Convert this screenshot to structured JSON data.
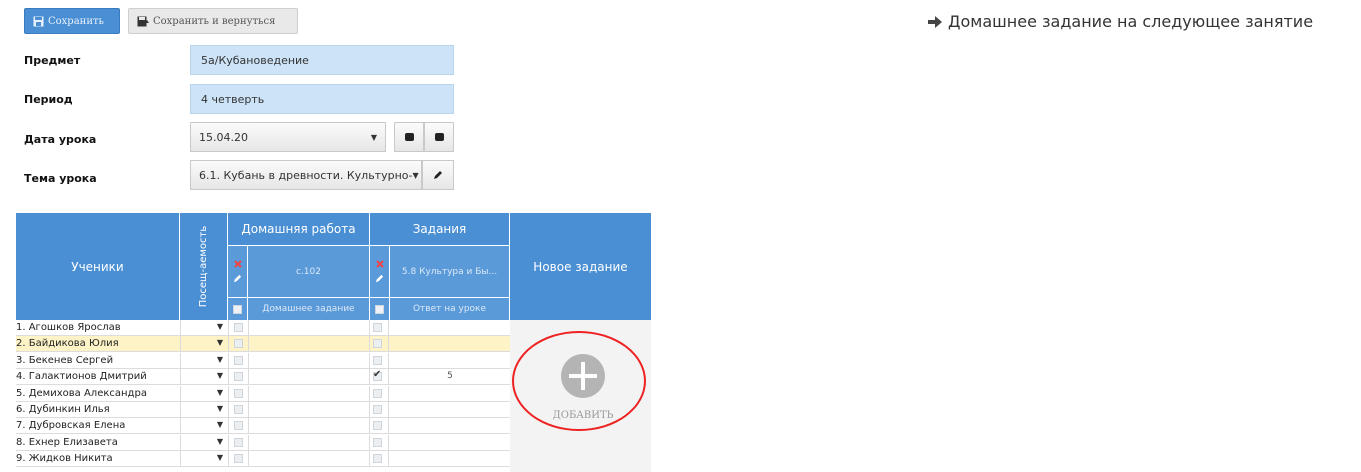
{
  "toolbar": {
    "save_label": "Сохранить",
    "save_return_label": "Сохранить и вернуться"
  },
  "top_link": {
    "label": "Домашнее задание на следующее занятие"
  },
  "form": {
    "subject_label": "Предмет",
    "subject_value": "5а/Кубановедение",
    "period_label": "Период",
    "period_value": "4 четверть",
    "date_label": "Дата урока",
    "date_value": "15.04.20",
    "topic_label": "Тема урока",
    "topic_value": "6.1. Кубань в древности. Культурно-"
  },
  "table": {
    "students_header": "Ученики",
    "attendance_header": "Посещ-аемость",
    "homework_header": "Домашняя работа",
    "tasks_header": "Задания",
    "new_task_header": "Новое задание",
    "homework_value": "с.102",
    "task_value": "5.8 Культура и Бы...",
    "homework_sub": "Домашнее задание",
    "task_sub": "Ответ на уроке",
    "add_label": "ДОБАВИТЬ",
    "students": [
      {
        "name": "1. Агошков Ярослав",
        "grade": "",
        "checked": false,
        "highlight": false
      },
      {
        "name": "2. Байдикова Юлия",
        "grade": "",
        "checked": false,
        "highlight": true
      },
      {
        "name": "3. Бекенев Сергей",
        "grade": "",
        "checked": false,
        "highlight": false
      },
      {
        "name": "4. Галактионов Дмитрий",
        "grade": "5",
        "checked": true,
        "highlight": false
      },
      {
        "name": "5. Демихова Александра",
        "grade": "",
        "checked": false,
        "highlight": false
      },
      {
        "name": "6. Дубинкин Илья",
        "grade": "",
        "checked": false,
        "highlight": false
      },
      {
        "name": "7. Дубровская Елена",
        "grade": "",
        "checked": false,
        "highlight": false
      },
      {
        "name": "8. Ехнер Елизавета",
        "grade": "",
        "checked": false,
        "highlight": false
      },
      {
        "name": "9. Жидков Никита",
        "grade": "",
        "checked": false,
        "highlight": false
      }
    ]
  },
  "colors": {
    "header_blue": "#4a8fd4",
    "field_blue": "#cde3f7",
    "highlight_row": "#fdf3c7",
    "ring_red": "#e22222"
  },
  "icons": [
    "save-icon",
    "save-return-icon",
    "arrow-right-icon",
    "delete-icon",
    "edit-icon",
    "plus-icon"
  ]
}
